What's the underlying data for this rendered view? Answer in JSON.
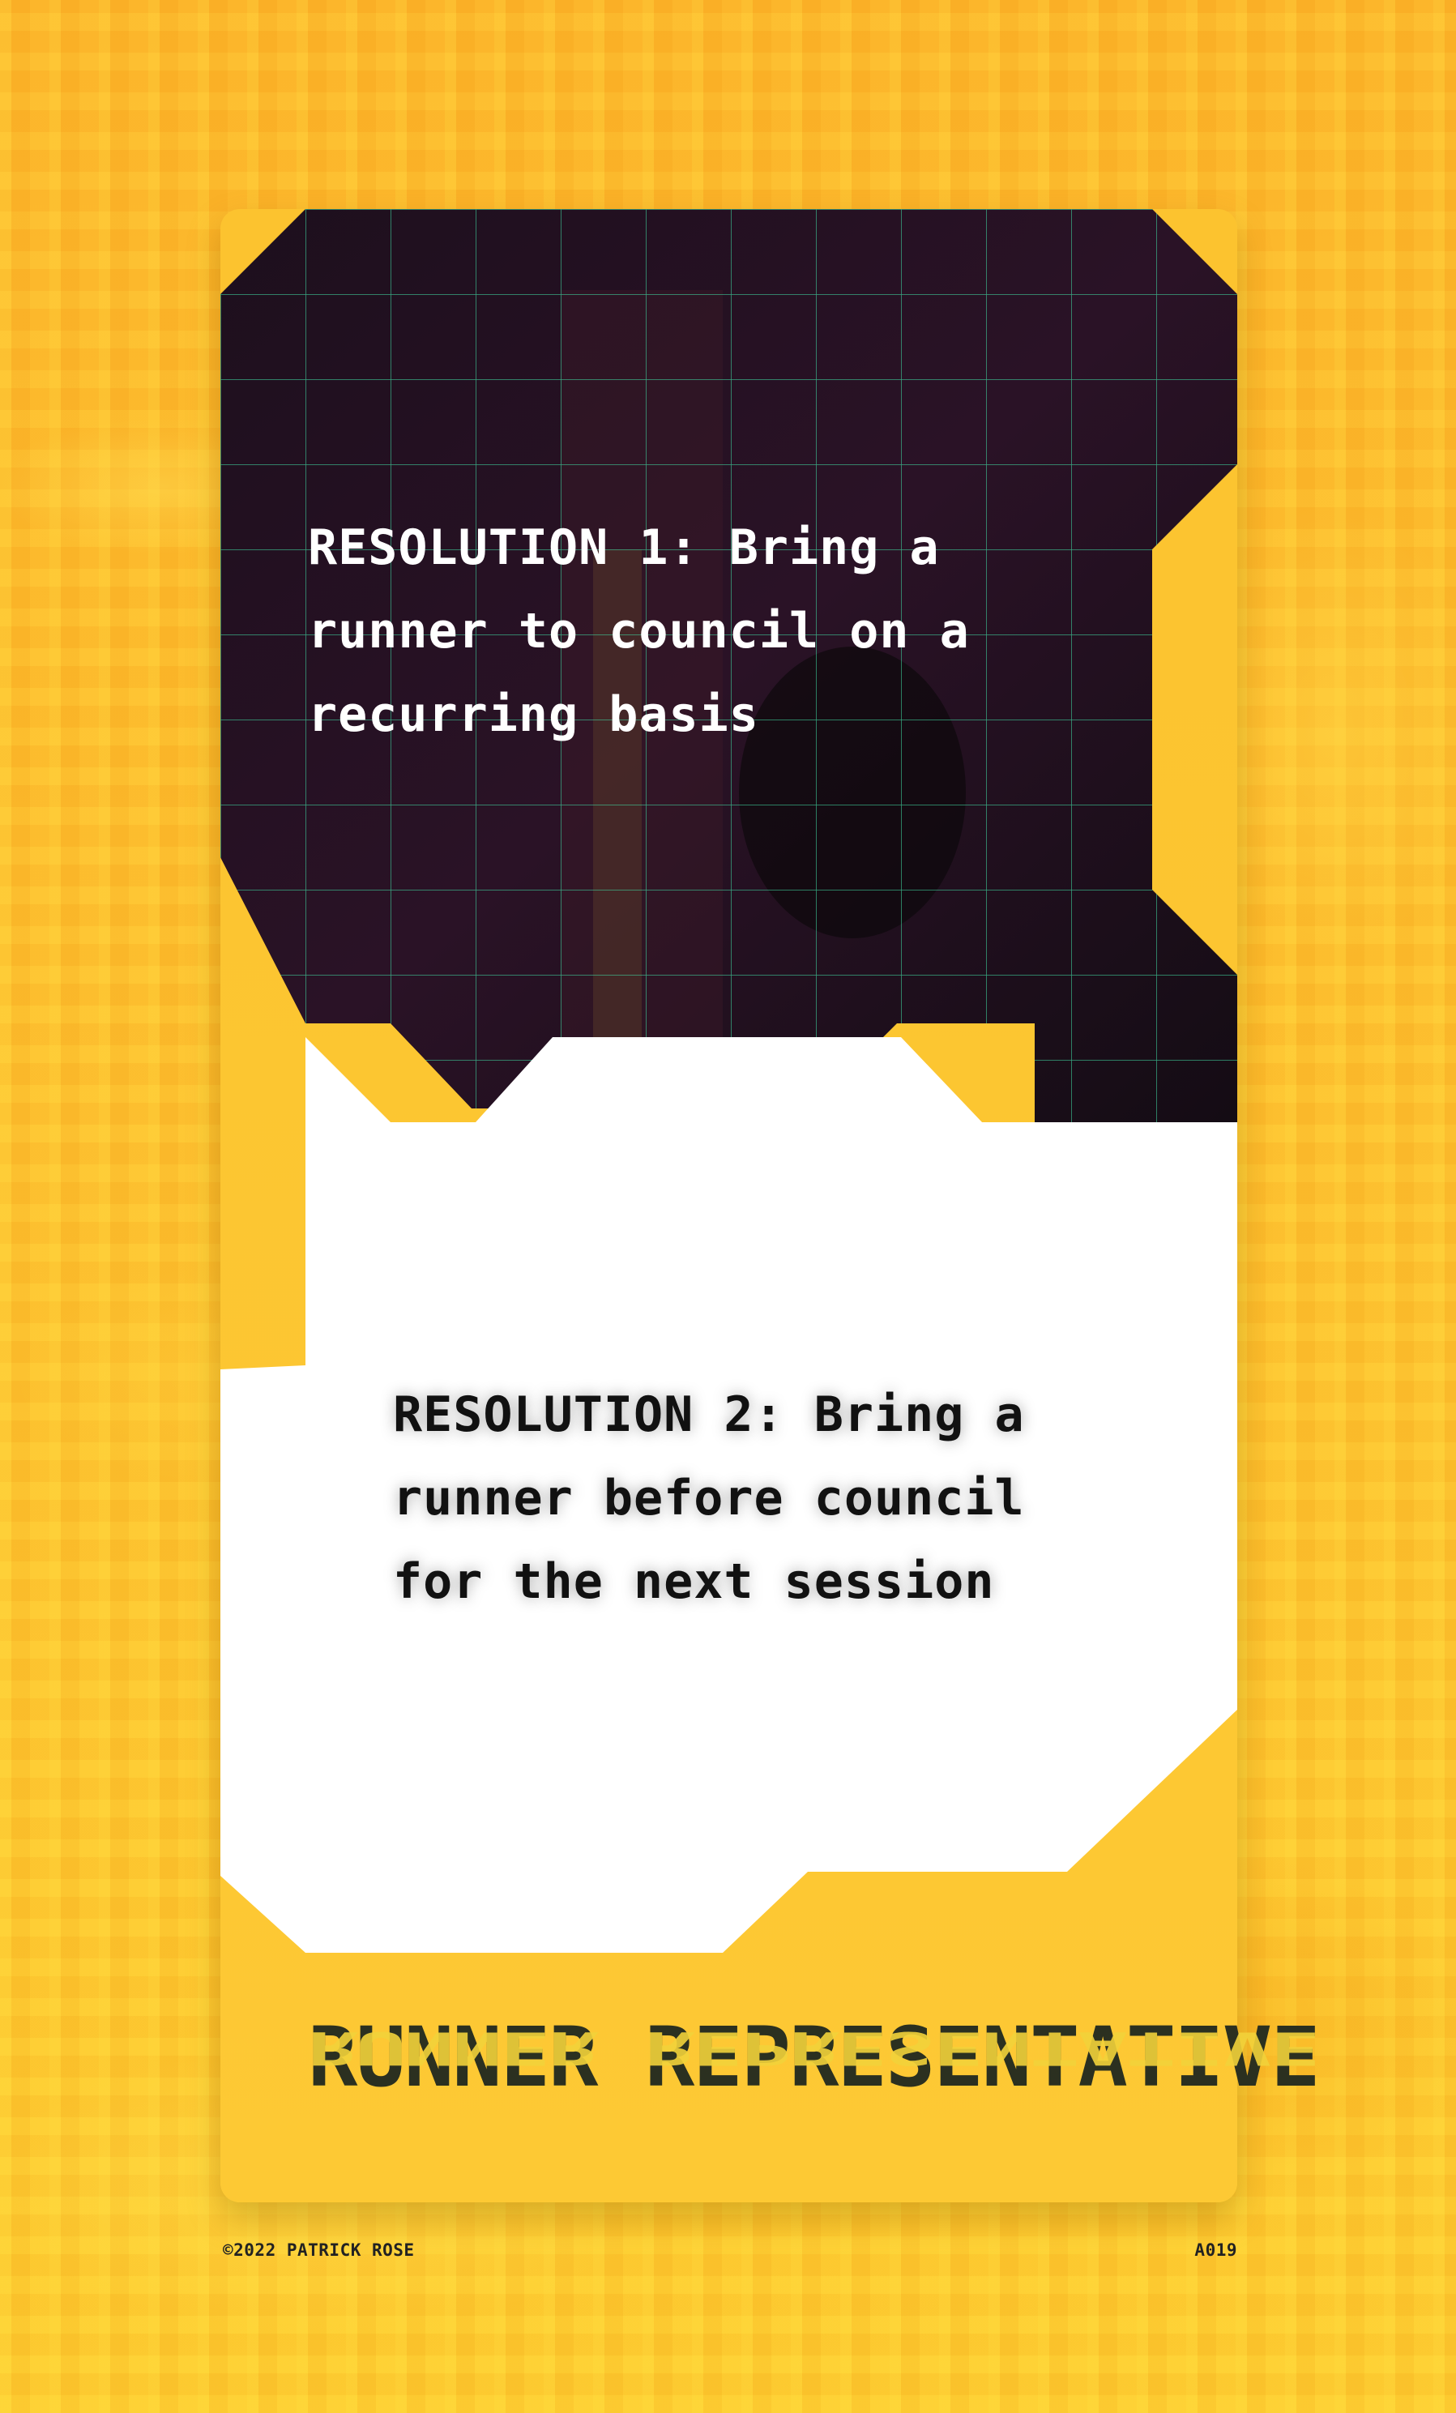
{
  "card": {
    "resolution_1": "RESOLUTION 1: Bring a runner to council on a recurring basis",
    "resolution_2": "RESOLUTION 2: Bring a runner before council for the next session",
    "title": "RUNNER REPRESENTATIVE"
  },
  "footer": {
    "copyright": "©2022 PATRICK ROSE",
    "card_id": "A019"
  },
  "colors": {
    "background": "#fdb92e",
    "card": "#fcc32f",
    "dark_panel": "#1a0f18",
    "grid_line": "#3fd6a0",
    "title_text": "#2b3020"
  }
}
